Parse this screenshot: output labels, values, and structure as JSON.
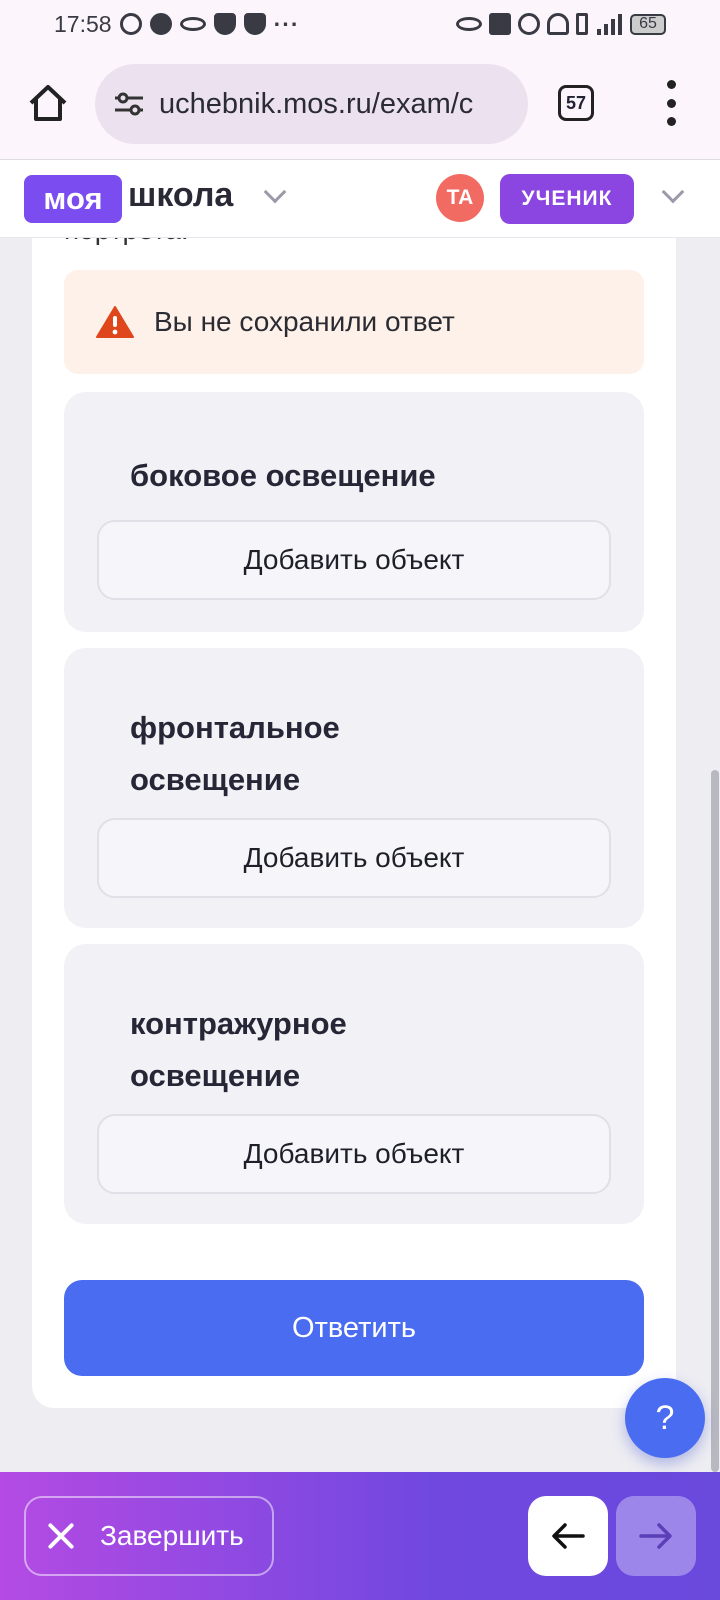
{
  "status_bar": {
    "time": "17:58",
    "dots": "···",
    "battery": "65"
  },
  "browser": {
    "url": "uchebnik.mos.ru/exam/c",
    "tab_count": "57"
  },
  "header": {
    "logo_box": "моя",
    "logo_text": "школа",
    "avatar_initials": "ТА",
    "role": "УЧЕНИК"
  },
  "content": {
    "cut_text": "портрета.",
    "warning": "Вы не сохранили ответ",
    "groups": [
      {
        "title_line1": "боковое освещение",
        "title_line2": "",
        "button": "Добавить объект"
      },
      {
        "title_line1": "фронтальное",
        "title_line2": "освещение",
        "button": "Добавить объект"
      },
      {
        "title_line1": "контражурное",
        "title_line2": "освещение",
        "button": "Добавить объект"
      }
    ],
    "answer_button": "Ответить",
    "help": "?"
  },
  "footer": {
    "finish": "Завершить"
  },
  "colors": {
    "primary": "#4a6cf0",
    "brand": "#7b4df0",
    "role_badge": "#8b45e0",
    "avatar": "#f26b62",
    "warning_bg": "#fdf1e9",
    "warning_icon": "#e0461c"
  }
}
